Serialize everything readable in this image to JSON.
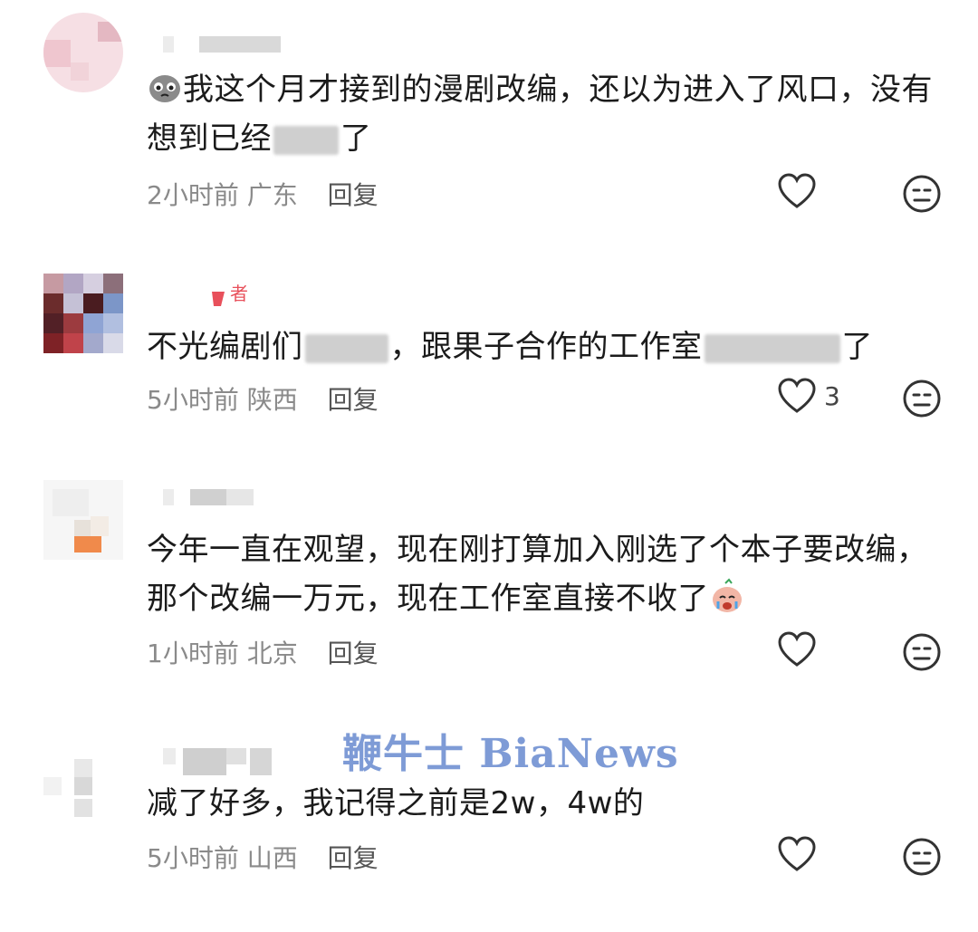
{
  "comments": [
    {
      "text_parts": [
        "我这个月才接到的漫剧改编，还以为进入了风口，没有想到已经",
        "",
        "了"
      ],
      "time": "2小时前",
      "location": "广东",
      "reply_label": "回复",
      "like_count": ""
    },
    {
      "text_parts": [
        "不光编剧们",
        "",
        "，跟果子合作的工作室",
        "",
        "了"
      ],
      "badge": "者",
      "time": "5小时前",
      "location": "陕西",
      "reply_label": "回复",
      "like_count": "3"
    },
    {
      "text_parts": [
        "今年一直在观望，现在刚打算加入刚选了个本子要改编，那个改编一万元，现在工作室直接不收了"
      ],
      "time": "1小时前",
      "location": "北京",
      "reply_label": "回复",
      "like_count": ""
    },
    {
      "text_parts": [
        "减了好多，我记得之前是2w，4w的"
      ],
      "time": "5小时前",
      "location": "山西",
      "reply_label": "回复",
      "like_count": ""
    }
  ],
  "watermark": "鞭牛士 BiaNews",
  "icons": {
    "like": "heart-outline-icon",
    "dislike": "neutral-face-icon",
    "emoji_1": "crying-face-emoji",
    "emoji_2": "sobbing-face-emoji"
  },
  "colors": {
    "text": "#1b1b1b",
    "meta": "#8a8a8a",
    "icon": "#333333",
    "watermark": "#7e9bd6",
    "badge": "#e8505b"
  }
}
